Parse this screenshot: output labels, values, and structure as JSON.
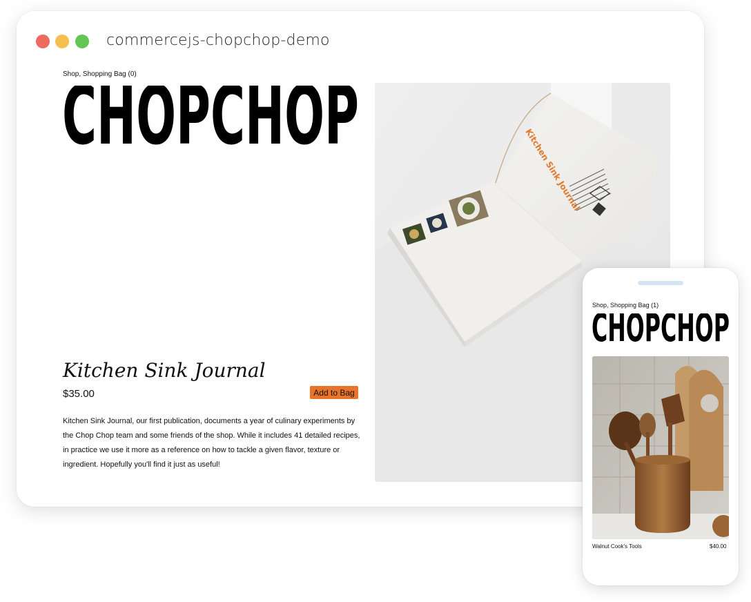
{
  "window": {
    "title": "commercejs-chopchop-demo"
  },
  "brand": {
    "logo_text": "CHOPCHOP"
  },
  "desktop": {
    "nav": "Shop, Shopping Bag (0)",
    "product": {
      "title": "Kitchen Sink Journal",
      "price": "$35.00",
      "add_label": "Add to Bag",
      "description": "Kitchen Sink Journal, our first publication, documents a year of culinary experiments by the Chop Chop team and some friends of the shop. While it includes 41 detailed recipes, in practice we use it more as a reference on how to tackle a given flavor, texture or ingredient. Hopefully you'll find it just as useful!"
    },
    "book_cover_text": "Kitchen Sink Journal"
  },
  "mobile": {
    "nav": "Shop, Shopping Bag (1)",
    "item": {
      "name": "Walnut Cook's Tools",
      "price": "$40.00"
    }
  },
  "colors": {
    "accent": "#e8742b",
    "traffic_red": "#ee6a5f",
    "traffic_yellow": "#f5be4f",
    "traffic_green": "#62c554",
    "phone_notch": "#d4e3f3"
  }
}
